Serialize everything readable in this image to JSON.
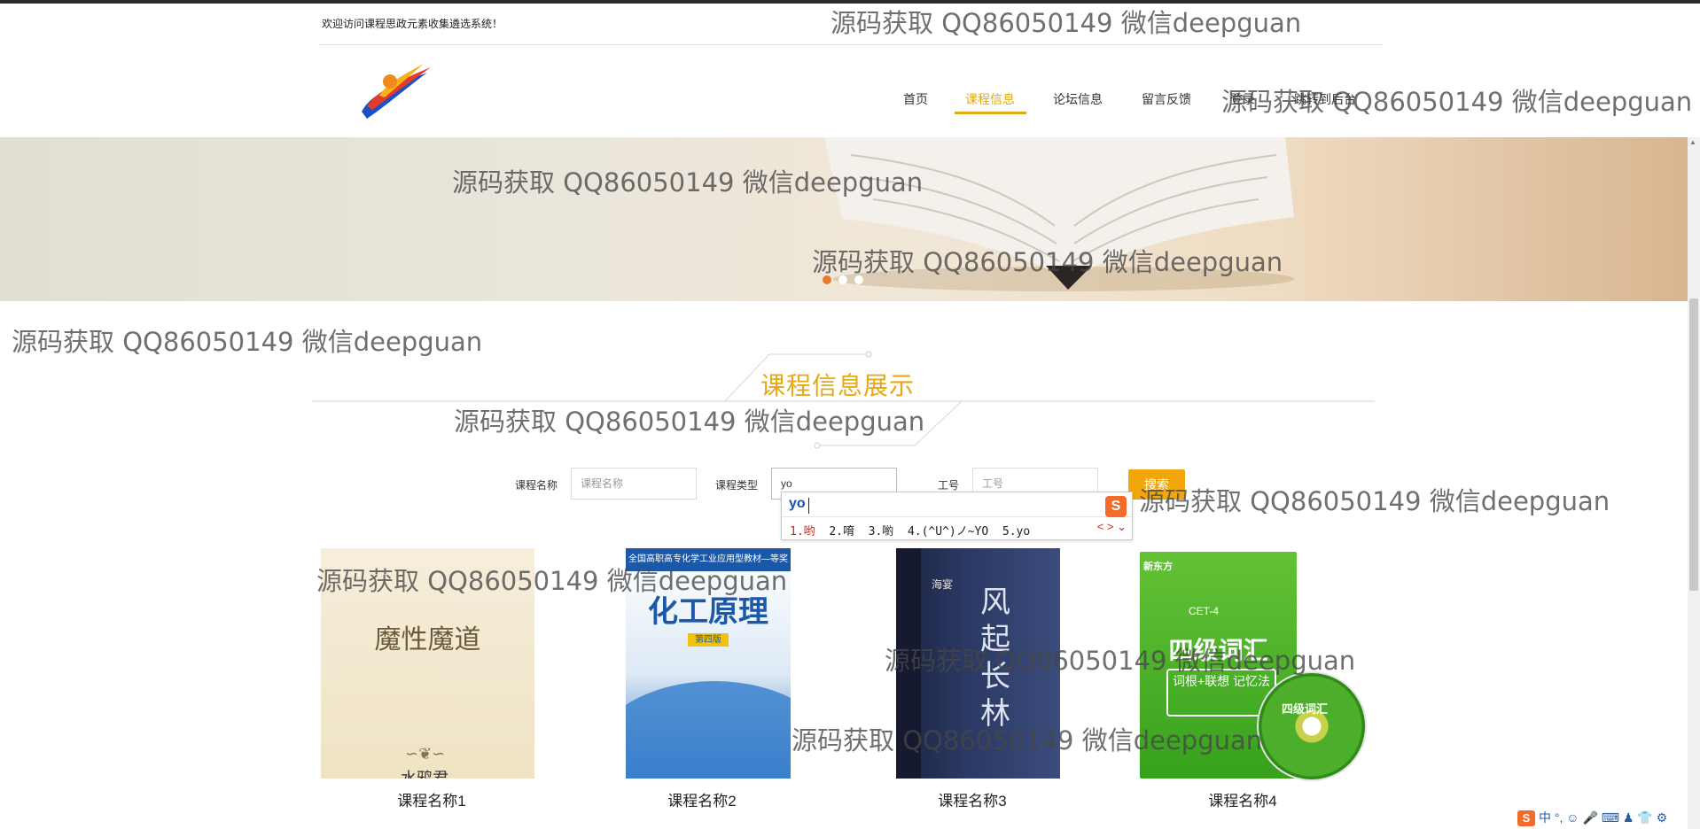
{
  "header": {
    "welcome": "欢迎访问课程思政元素收集遴选系统！",
    "logo_icon": "swirl-logo-icon",
    "nav": [
      {
        "label": "首页",
        "active": false
      },
      {
        "label": "课程信息",
        "active": true
      },
      {
        "label": "论坛信息",
        "active": false
      },
      {
        "label": "留言反馈",
        "active": false
      },
      {
        "label": "登录",
        "active": false
      },
      {
        "label": "跳转到后台",
        "active": false
      }
    ]
  },
  "banner": {
    "slides_total": 3,
    "current_slide": 1
  },
  "section": {
    "title": "课程信息展示"
  },
  "search": {
    "name_label": "课程名称",
    "name_placeholder": "课程名称",
    "type_label": "课程类型",
    "type_value": "yo",
    "worker_label": "工号",
    "worker_placeholder": "工号",
    "button_label": "搜索"
  },
  "ime": {
    "input": "yo",
    "candidates": [
      "1.哟",
      "2.唷",
      "3.喲",
      "4.(^U^)ノ~YO",
      "5.yo"
    ],
    "nav": "< > ⌄",
    "logo": "S"
  },
  "cards": [
    {
      "label": "课程名称1",
      "cover_title": "魔性魔道",
      "cover_author": "水鸦君",
      "ornament": "∽❦∽"
    },
    {
      "label": "课程名称2",
      "cover_title": "化工原理",
      "cover_header": "全国高职高专化学工业应用型教材—等奖",
      "cover_edition": "第四版"
    },
    {
      "label": "课程名称3",
      "cover_title": "风起长林",
      "cover_author": "海宴"
    },
    {
      "label": "课程名称4",
      "cover_title": "四级词汇",
      "cover_series": "CET-4",
      "cover_sub": "词根+联想 记忆法",
      "cover_brand": "新东方",
      "cd_title": "四级词汇"
    }
  ],
  "watermark": "源码获取 QQ86050149 微信deepguan",
  "tray": {
    "logo": "S",
    "text": "中 °, ☺ 🎤 ⌨ ♟ 👕 ⚙"
  },
  "colors": {
    "accent": "#e6a817",
    "active_dot": "#e87a30",
    "button": "#f2a60c"
  }
}
